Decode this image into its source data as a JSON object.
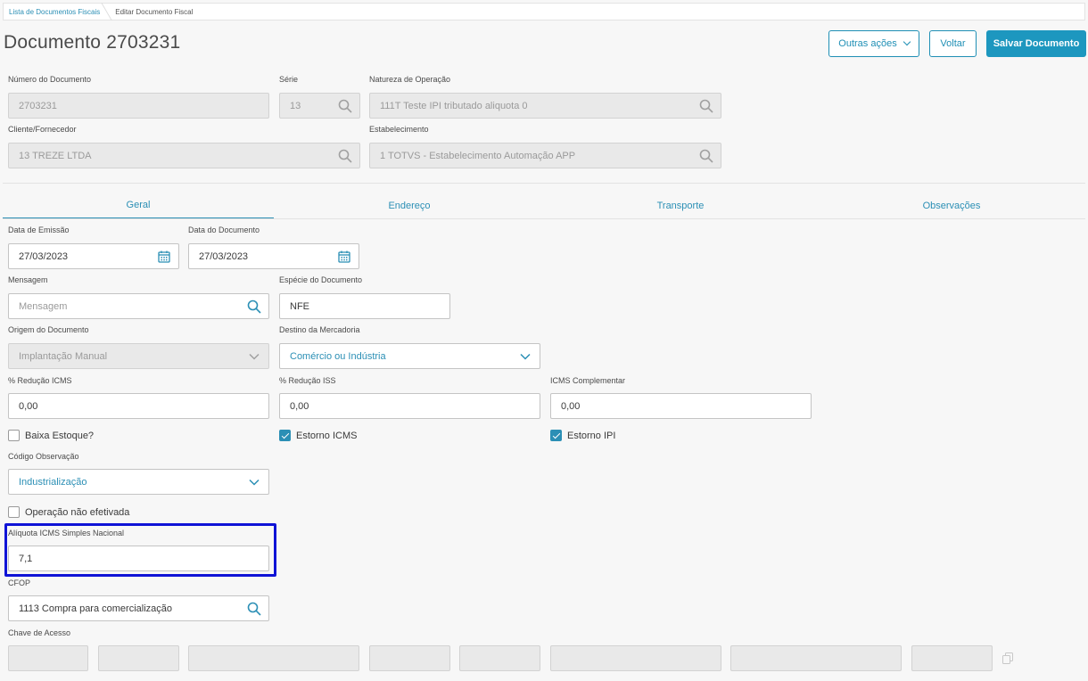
{
  "breadcrumb": {
    "items": [
      "Lista de Documentos Fiscais",
      "Editar Documento Fiscal"
    ]
  },
  "header": {
    "title": "Documento 2703231",
    "actions": {
      "more_label": "Outras ações",
      "back_label": "Voltar",
      "save_label": "Salvar Documento"
    }
  },
  "document": {
    "numero_label": "Número do Documento",
    "numero_value": "2703231",
    "serie_label": "Série",
    "serie_value": "13",
    "natureza_label": "Natureza de Operação",
    "natureza_value": "111T  Teste IPI tributado aliquota 0",
    "cliente_label": "Cliente/Fornecedor",
    "cliente_value": "13  TREZE LTDA",
    "estab_label": "Estabelecimento",
    "estab_value": "1  TOTVS - Estabelecimento Automação APP"
  },
  "tabs": [
    "Geral",
    "Endereço",
    "Transporte",
    "Observações"
  ],
  "geral": {
    "data_emissao_label": "Data de Emissão",
    "data_emissao_value": "27/03/2023",
    "data_documento_label": "Data do Documento",
    "data_documento_value": "27/03/2023",
    "mensagem_label": "Mensagem",
    "mensagem_placeholder": "Mensagem",
    "especie_label": "Espécie do Documento",
    "especie_value": "NFE",
    "origem_label": "Origem do Documento",
    "origem_value": "Implantação Manual",
    "destino_label": "Destino da Mercadoria",
    "destino_value": "Comércio ou Indústria",
    "reducao_icms_label": "% Redução ICMS",
    "reducao_icms_value": "0,00",
    "reducao_iss_label": "% Redução ISS",
    "reducao_iss_value": "0,00",
    "icms_comp_label": "ICMS Complementar",
    "icms_comp_value": "0,00",
    "baixa_estoque_label": "Baixa Estoque?",
    "baixa_estoque_checked": false,
    "estorno_icms_label": "Estorno ICMS",
    "estorno_icms_checked": true,
    "estorno_ipi_label": "Estorno IPI",
    "estorno_ipi_checked": true,
    "codigo_obs_label": "Código Observação",
    "codigo_obs_value": "Industrialização",
    "operacao_label": "Operação não efetivada",
    "operacao_checked": false,
    "aliquota_label": "Alíquota ICMS Simples Nacional",
    "aliquota_value": "7,1",
    "cfop_label": "CFOP",
    "cfop_value": "1113  Compra para comercialização",
    "chave_label": "Chave de Acesso"
  },
  "colors": {
    "accent": "#2b8fb5",
    "primary_button": "#1d97bf",
    "highlight": "#0f13d6"
  }
}
